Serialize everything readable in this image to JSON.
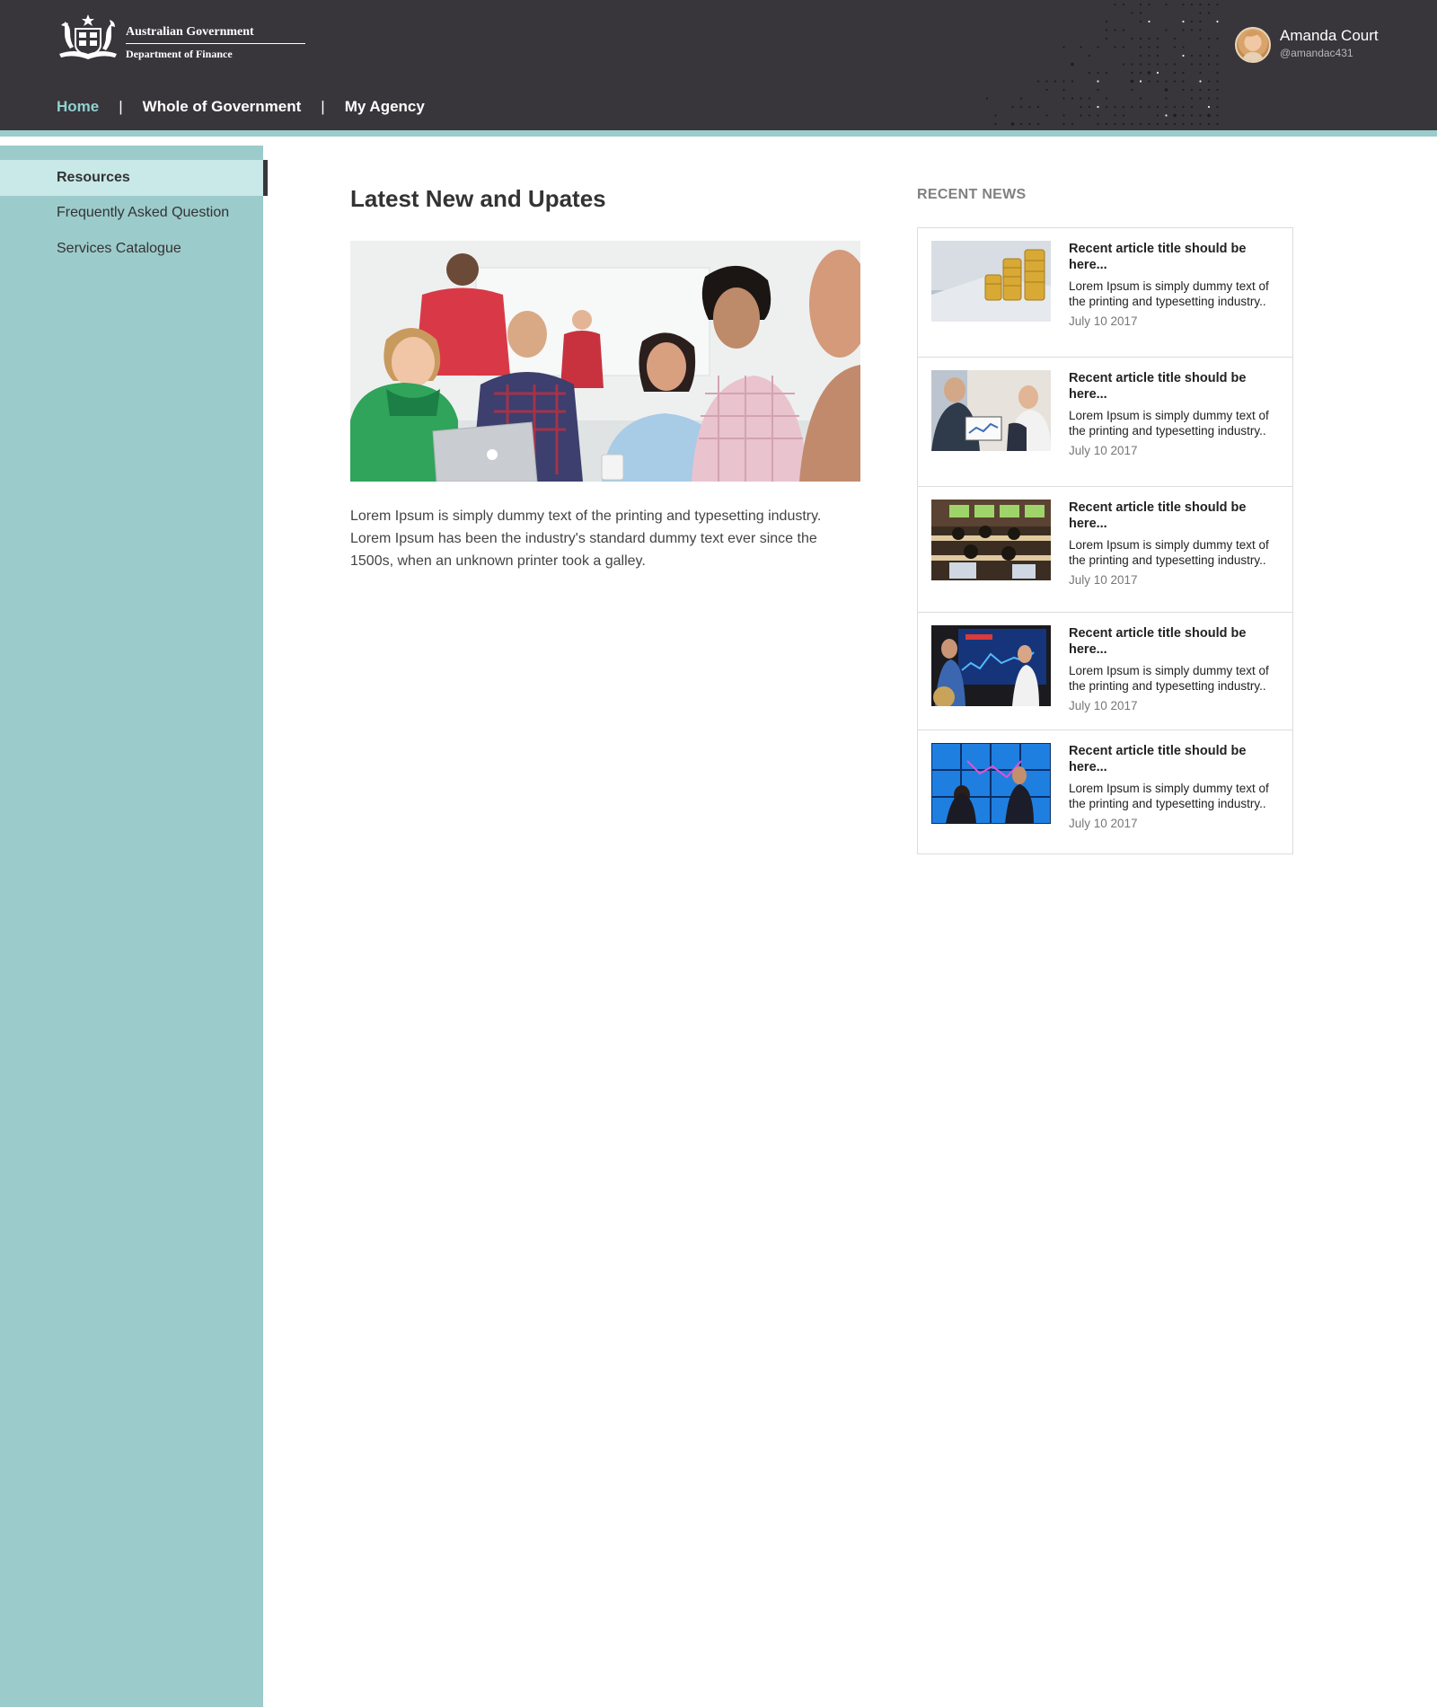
{
  "header": {
    "logo": {
      "line1": "Australian Government",
      "line2": "Department of Finance",
      "icon": "coat-of-arms-icon"
    },
    "nav": [
      {
        "label": "Home",
        "active": true
      },
      {
        "label": "Whole of Government",
        "active": false
      },
      {
        "label": "My Agency",
        "active": false
      }
    ],
    "nav_separator": "|",
    "user": {
      "name": "Amanda Court",
      "handle": "@amandac431"
    }
  },
  "sidebar": {
    "items": [
      {
        "label": "Resources",
        "active": true
      },
      {
        "label": "Frequently Asked Question",
        "active": false
      },
      {
        "label": "Services Catalogue",
        "active": false
      }
    ]
  },
  "main": {
    "title": "Latest New and Upates",
    "intro": "Lorem Ipsum is simply dummy text of the printing and typesetting industry. Lorem Ipsum has been the industry's standard dummy text ever since the 1500s, when an unknown printer took a galley."
  },
  "recent_news": {
    "heading": "RECENT NEWS",
    "items": [
      {
        "title": "Recent article title should be here...",
        "text": "Lorem Ipsum is simply dummy text of the printing and typesetting industry..",
        "date": "July 10 2017",
        "image": "gold-coins"
      },
      {
        "title": "Recent article title should be here...",
        "text": "Lorem Ipsum is simply dummy text of the printing and typesetting industry..",
        "date": "July 10 2017",
        "image": "people-with-tablet"
      },
      {
        "title": "Recent article title should be here...",
        "text": "Lorem Ipsum is simply dummy text of the printing and typesetting industry..",
        "date": "July 10 2017",
        "image": "control-room"
      },
      {
        "title": "Recent article title should be here...",
        "text": "Lorem Ipsum is simply dummy text of the printing and typesetting industry..",
        "date": "July 10 2017",
        "image": "presentation-screen"
      },
      {
        "title": "Recent article title should be here...",
        "text": "Lorem Ipsum is simply dummy text of the printing and typesetting industry..",
        "date": "July 10 2017",
        "image": "data-wall"
      }
    ]
  },
  "colors": {
    "header_bg": "#38353b",
    "accent_teal": "#9ccbcb",
    "active_nav": "#8fd2d0",
    "sidebar_active_bg": "#c9e8e8"
  }
}
